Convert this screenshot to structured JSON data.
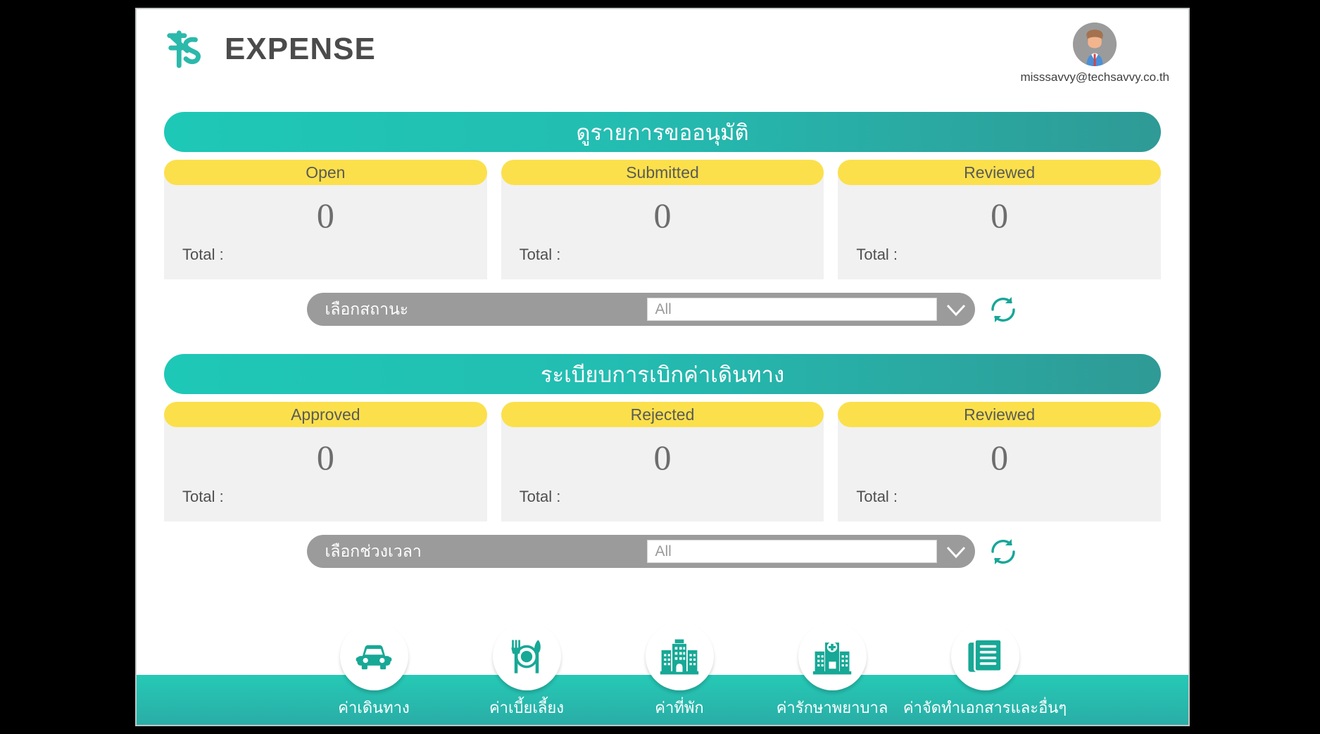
{
  "header": {
    "brand_title": "EXPENSE",
    "logo_icon": "ts-logo-icon",
    "avatar_icon": "user-avatar-icon",
    "user_email": "misssavvy@techsavvy.co.th"
  },
  "theme": {
    "teal_light": "#1EC8B6",
    "teal_dark": "#2F9A96",
    "yellow": "#FBE04C",
    "card_bg": "#F1F1F1",
    "filter_grey": "#9B9B9B",
    "text_grey": "#6D6D6D"
  },
  "sections": [
    {
      "title": "ดูรายการขออนุมัติ",
      "cards": [
        {
          "label": "Open",
          "value": "0",
          "total_label": "Total :"
        },
        {
          "label": "Submitted",
          "value": "0",
          "total_label": "Total :"
        },
        {
          "label": "Reviewed",
          "value": "0",
          "total_label": "Total :"
        }
      ],
      "filter": {
        "label": "เลือกสถานะ",
        "value": "All",
        "placeholder": "All",
        "chevron_icon": "chevron-down-icon",
        "refresh_icon": "refresh-icon"
      }
    },
    {
      "title": "ระเบียบการเบิกค่าเดินทาง",
      "cards": [
        {
          "label": "Approved",
          "value": "0",
          "total_label": "Total :"
        },
        {
          "label": "Rejected",
          "value": "0",
          "total_label": "Total :"
        },
        {
          "label": "Reviewed",
          "value": "0",
          "total_label": "Total :"
        }
      ],
      "filter": {
        "label": "เลือกช่วงเวลา",
        "value": "All",
        "placeholder": "All",
        "chevron_icon": "chevron-down-icon",
        "refresh_icon": "refresh-icon"
      }
    }
  ],
  "bottom_nav": [
    {
      "label": "ค่าเดินทาง",
      "icon": "car-icon"
    },
    {
      "label": "ค่าเบี้ยเลี้ยง",
      "icon": "meal-icon"
    },
    {
      "label": "ค่าที่พัก",
      "icon": "hotel-icon"
    },
    {
      "label": "ค่ารักษาพยาบาล",
      "icon": "hospital-icon"
    },
    {
      "label": "ค่าจัดทำเอกสารและอื่นๆ",
      "icon": "documents-icon"
    }
  ]
}
